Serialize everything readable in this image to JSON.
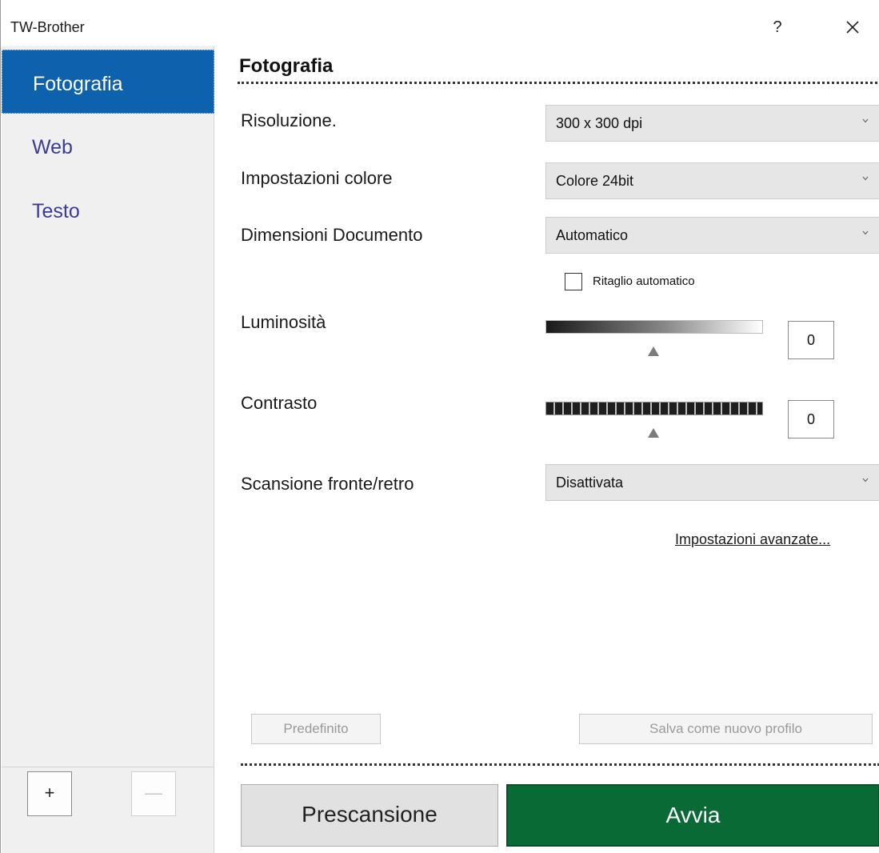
{
  "window": {
    "title": "TW-Brother",
    "help_label": "?"
  },
  "sidebar": {
    "items": [
      {
        "label": "Fotografia",
        "selected": true
      },
      {
        "label": "Web",
        "selected": false
      },
      {
        "label": "Testo",
        "selected": false
      }
    ],
    "add_label": "+",
    "remove_label": "—"
  },
  "main": {
    "title": "Fotografia",
    "settings": {
      "resolution": {
        "label": "Risoluzione.",
        "value": "300 x 300 dpi"
      },
      "color": {
        "label": "Impostazioni colore",
        "value": "Colore 24bit"
      },
      "document_size": {
        "label": "Dimensioni Documento",
        "value": "Automatico"
      },
      "auto_crop": {
        "label": "Ritaglio automatico",
        "checked": false
      },
      "brightness": {
        "label": "Luminosità",
        "value": "0"
      },
      "contrast": {
        "label": "Contrasto",
        "value": "0"
      },
      "duplex": {
        "label": "Scansione fronte/retro",
        "value": "Disattivata"
      }
    },
    "advanced_link": "Impostazioni avanzate...",
    "default_button": "Predefinito",
    "save_profile_button": "Salva come nuovo profilo",
    "prescan_button": "Prescansione",
    "start_button": "Avvia"
  },
  "colors": {
    "selected_bg": "#0d61ad",
    "start_bg": "#0a6a36",
    "nav_text": "#3b3b95"
  }
}
